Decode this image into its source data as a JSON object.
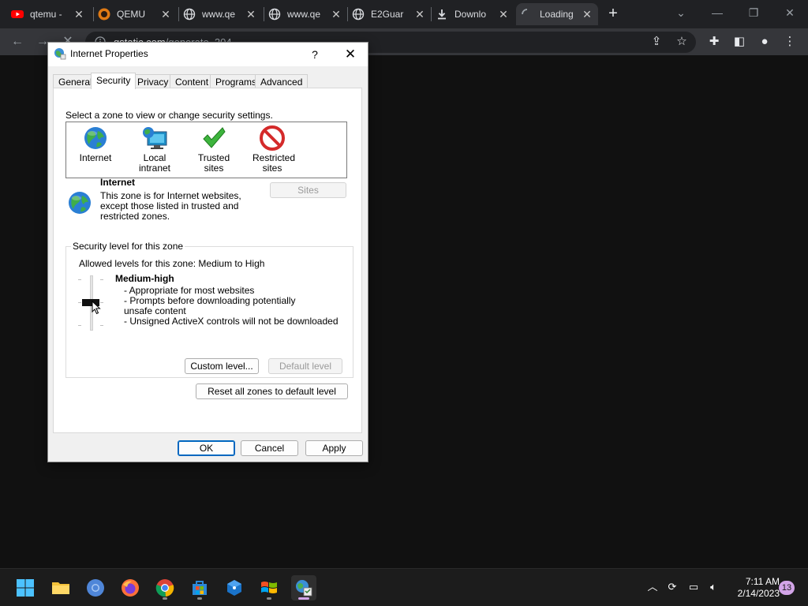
{
  "browser": {
    "tabs": [
      {
        "label": "qtemu -",
        "icon": "youtube-icon",
        "close": "✕"
      },
      {
        "label": "QEMU",
        "icon": "qemu-icon",
        "close": "✕"
      },
      {
        "label": "www.qe",
        "icon": "globe-icon",
        "close": "✕"
      },
      {
        "label": "www.qe",
        "icon": "globe-icon",
        "close": "✕"
      },
      {
        "label": "E2Guar",
        "icon": "globe-icon",
        "close": "✕"
      },
      {
        "label": "Downlo",
        "icon": "download-icon",
        "close": "✕"
      },
      {
        "label": "Loading",
        "icon": "spinner-icon",
        "close": "✕"
      }
    ],
    "new_tab": "+",
    "address_host": "gstatic.com",
    "address_path": "/generate_204"
  },
  "dialog": {
    "title": "Internet Properties",
    "help": "?",
    "close": "✕",
    "tabs": [
      "General",
      "Security",
      "Privacy",
      "Content",
      "Programs",
      "Advanced"
    ],
    "selected_tab": "Security",
    "zone_prompt": "Select a zone to view or change security settings.",
    "zones": [
      {
        "label": "Internet",
        "icon": "globe-icon"
      },
      {
        "label": "Local intranet",
        "icon": "monitor-globe-icon"
      },
      {
        "label": "Trusted sites",
        "icon": "checkmark-icon"
      },
      {
        "label": "Restricted sites",
        "icon": "no-entry-icon"
      }
    ],
    "zone_info": {
      "title": "Internet",
      "description": "This zone is for Internet websites, except those listed in trusted and restricted zones."
    },
    "sites_button": "Sites",
    "security_group": {
      "legend": "Security level for this zone",
      "allowed": "Allowed levels for this zone: Medium to High",
      "level_title": "Medium-high",
      "level_lines": [
        "- Appropriate for most websites",
        "- Prompts before downloading potentially unsafe content",
        "- Unsigned ActiveX controls will not be downloaded"
      ],
      "custom_button": "Custom level...",
      "default_button": "Default level"
    },
    "reset_button": "Reset all zones to default level",
    "ok_button": "OK",
    "cancel_button": "Cancel",
    "apply_button": "Apply"
  },
  "taskbar": {
    "time": "7:11 AM",
    "date": "2/14/2023",
    "notifications": "13"
  },
  "colors": {
    "accent": "#0067c0",
    "chrome_dark": "#202124",
    "taskbar": "#1c1c1c"
  }
}
